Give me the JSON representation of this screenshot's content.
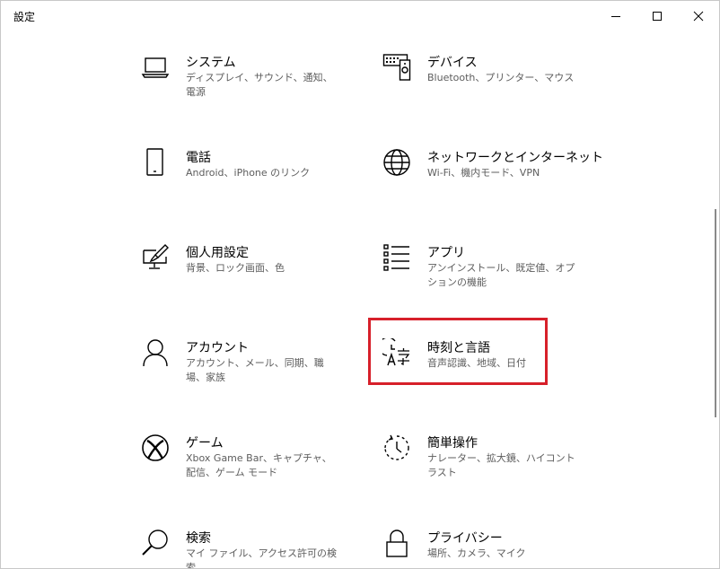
{
  "window": {
    "title": "設定",
    "minimize_label": "最小化",
    "maximize_label": "最大化",
    "close_label": "閉じる"
  },
  "tiles": [
    {
      "title": "システム",
      "description": "ディスプレイ、サウンド、通知、電源",
      "icon": "laptop-icon"
    },
    {
      "title": "デバイス",
      "description": "Bluetooth、プリンター、マウス",
      "icon": "devices-icon"
    },
    {
      "title": "電話",
      "description": "Android、iPhone のリンク",
      "icon": "phone-icon"
    },
    {
      "title": "ネットワークとインターネット",
      "description": "Wi-Fi、機内モード、VPN",
      "icon": "globe-icon"
    },
    {
      "title": "個人用設定",
      "description": "背景、ロック画面、色",
      "icon": "personalization-icon"
    },
    {
      "title": "アプリ",
      "description": "アンインストール、既定値、オプションの機能",
      "icon": "apps-list-icon"
    },
    {
      "title": "アカウント",
      "description": "アカウント、メール、同期、職場、家族",
      "icon": "person-icon"
    },
    {
      "title": "時刻と言語",
      "description": "音声認識、地域、日付",
      "icon": "time-language-icon"
    },
    {
      "title": "ゲーム",
      "description": "Xbox Game Bar、キャプチャ、配信、ゲーム モード",
      "icon": "xbox-icon"
    },
    {
      "title": "簡単操作",
      "description": "ナレーター、拡大鏡、ハイコントラスト",
      "icon": "ease-of-access-icon"
    },
    {
      "title": "検索",
      "description": "マイ ファイル、アクセス許可の検索",
      "icon": "search-icon"
    },
    {
      "title": "プライバシー",
      "description": "場所、カメラ、マイク",
      "icon": "lock-icon"
    }
  ],
  "highlight": {
    "target": "時刻と言語",
    "color": "#d7202a"
  }
}
